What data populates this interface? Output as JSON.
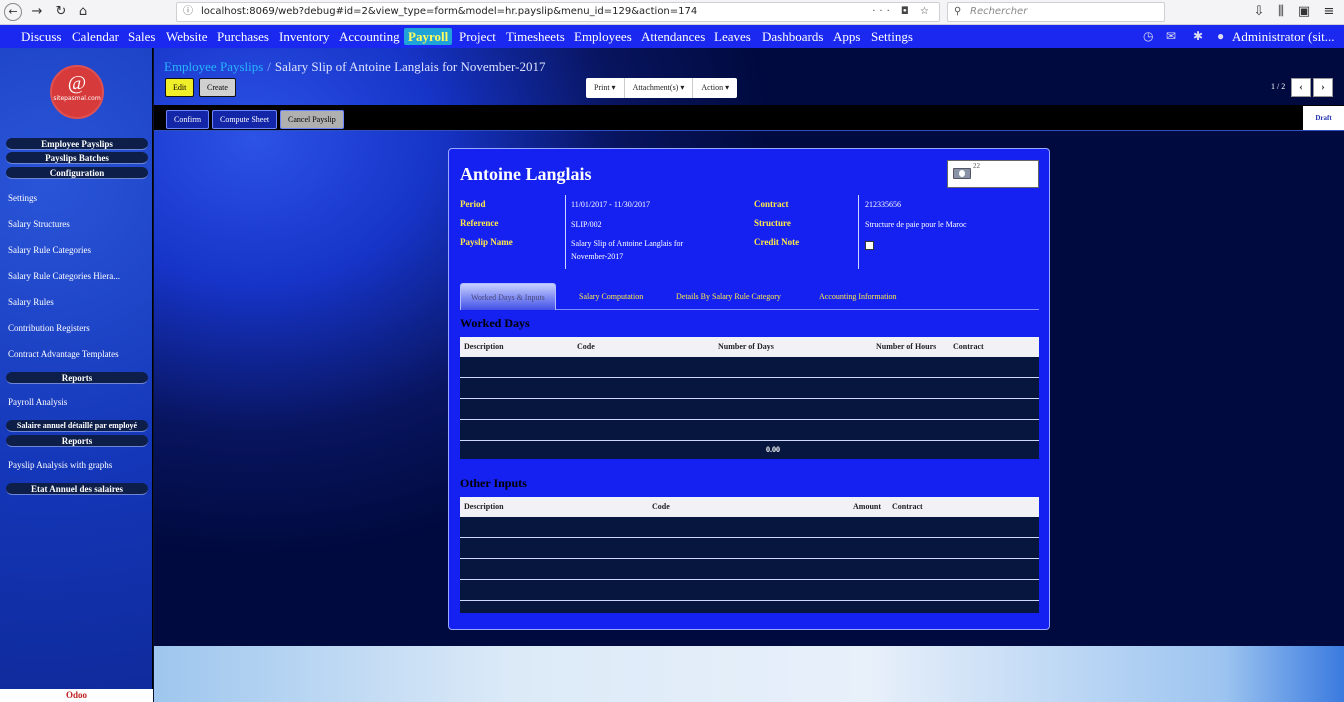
{
  "browser": {
    "url": "localhost:8069/web?debug#id=2&view_type=form&model=hr.payslip&menu_id=129&action=174",
    "search_placeholder": "Rechercher"
  },
  "nav": {
    "items": [
      "Discuss",
      "Calendar",
      "Sales",
      "Website",
      "Purchases",
      "Inventory",
      "Accounting",
      "Payroll",
      "Project",
      "Timesheets",
      "Employees",
      "Attendances",
      "Leaves",
      "Dashboards",
      "Apps",
      "Settings"
    ],
    "active": "Payroll",
    "user": "Administrator (sit..."
  },
  "sidebar": {
    "logo_text": "sitepasmal.com",
    "logo_symbol": "@",
    "headers": [
      "Employee Payslips",
      "Payslips Batches",
      "Configuration",
      "Reports",
      "Salaire annuel détaillé par employé",
      "Reports",
      "Etat Annuel des salaires"
    ],
    "config_items": [
      "Settings",
      "Salary Structures",
      "Salary Rule Categories",
      "Salary Rule Categories Hiera...",
      "Salary Rules",
      "Contribution Registers",
      "Contract Advantage Templates"
    ],
    "report_items": [
      "Payroll Analysis"
    ],
    "report_items2": [
      "Payslip Analysis with graphs"
    ],
    "footer": "Odoo"
  },
  "breadcrumb": {
    "parent": "Employee Payslips",
    "separator": "/",
    "current": "Salary Slip of Antoine Langlais for November-2017"
  },
  "toolbar": {
    "edit": "Edit",
    "create": "Create",
    "print": "Print ▾",
    "attachments": "Attachment(s) ▾",
    "action": "Action ▾",
    "pager": "1 / 2",
    "prev": "‹",
    "next": "›"
  },
  "status_bar": {
    "confirm": "Confirm",
    "compute": "Compute Sheet",
    "cancel": "Cancel Payslip",
    "state": "Draft"
  },
  "form": {
    "employee": "Antoine Langlais",
    "stat_count": "22",
    "period_label": "Period",
    "period": "11/01/2017 - 11/30/2017",
    "reference_label": "Reference",
    "reference": "SLIP/002",
    "payslip_name_label": "Payslip Name",
    "payslip_name_1": "Salary Slip of Antoine Langlais for",
    "payslip_name_2": "November-2017",
    "contract_label": "Contract",
    "contract": "212335656",
    "structure_label": "Structure",
    "structure": "Structure de paie pour le Maroc",
    "credit_note_label": "Credit Note",
    "credit_note": false
  },
  "tabs": [
    "Worked Days & Inputs",
    "Salary Computation",
    "Details By Salary Rule Category",
    "Accounting Information"
  ],
  "worked_days": {
    "title": "Worked Days",
    "columns": [
      "Description",
      "Code",
      "Number of Days",
      "Number of Hours",
      "Contract"
    ],
    "total": "0.00"
  },
  "other_inputs": {
    "title": "Other Inputs",
    "columns": [
      "Description",
      "Code",
      "Amount",
      "Contract"
    ]
  },
  "colors": {
    "nav_bg": "#1a28f0",
    "active_tab": "#1fa3d8",
    "field_label": "#ffe94a",
    "sheet_bg": "#1521f0"
  }
}
